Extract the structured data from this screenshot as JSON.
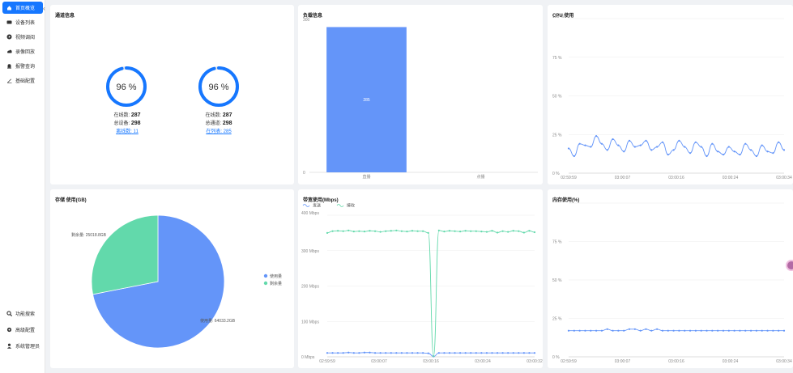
{
  "sidebar": {
    "collapse_glyph": "‹",
    "top_items": [
      {
        "label": "首页概览",
        "icon": "home-icon"
      },
      {
        "label": "设备列表",
        "icon": "device-icon"
      },
      {
        "label": "视频调阅",
        "icon": "video-icon"
      },
      {
        "label": "录像回放",
        "icon": "playback-icon"
      },
      {
        "label": "报警查询",
        "icon": "alarm-icon"
      },
      {
        "label": "基础配置",
        "icon": "config-icon"
      }
    ],
    "bottom_items": [
      {
        "label": "功能搜索",
        "icon": "search-icon"
      },
      {
        "label": "高级配置",
        "icon": "gear-icon"
      },
      {
        "label": "系统管理员",
        "icon": "user-icon"
      }
    ],
    "active_color": "#1677ff"
  },
  "resource": {
    "title": "通道信息",
    "gauges": [
      {
        "percent_label": "96 %",
        "percent": 96,
        "line1_label": "在线数:",
        "line1_value": "287",
        "line2_label": "总设备:",
        "line2_value": "298",
        "link_label": "离线数:",
        "link_value": "11"
      },
      {
        "percent_label": "96 %",
        "percent": 96,
        "line1_label": "在线数:",
        "line1_value": "287",
        "line2_label": "总通道:",
        "line2_value": "298",
        "link_label": "在列表:",
        "link_value": "285"
      }
    ]
  },
  "load": {
    "title": "负载信息",
    "chart_data": {
      "type": "bar",
      "categories": [
        "直播",
        "点播"
      ],
      "values": [
        285,
        0
      ],
      "data_labels": [
        "285",
        ""
      ],
      "ylim": [
        0,
        300
      ],
      "y_ticks": [
        "300",
        "0"
      ],
      "color": "#6495f9"
    }
  },
  "cpu": {
    "title": "CPU 使用",
    "chart_data": {
      "type": "line",
      "y_ticks": [
        "100 %",
        "75 %",
        "50 %",
        "25 %",
        "0 %"
      ],
      "x_ticks": [
        "02:59:59",
        "03:00:07",
        "03:00:16",
        "03:00:24",
        "03:00:34"
      ],
      "ylim": [
        0,
        100
      ],
      "values": [
        16,
        11,
        19,
        18,
        17,
        24,
        19,
        15,
        22,
        18,
        14,
        21,
        17,
        18,
        21,
        15,
        17,
        20,
        12,
        15,
        21,
        17,
        13,
        20,
        17,
        11,
        19,
        14,
        12,
        17,
        14,
        12,
        19,
        15,
        11,
        18,
        14,
        13,
        20,
        15
      ]
    }
  },
  "storage": {
    "title": "存储 使用(GB)",
    "chart_data": {
      "type": "pie",
      "slices": [
        {
          "name": "使用量",
          "value": 64033.2,
          "label": "使用量: 64033.2GB",
          "color": "#6495f9"
        },
        {
          "name": "剩余量",
          "value": 25018.8,
          "label": "剩余量: 25018.8GB",
          "color": "#62d9ab"
        }
      ],
      "legend": [
        "使用量",
        "剩余量"
      ],
      "legend_position": "right"
    }
  },
  "bandwidth": {
    "title": "带宽使用(Mbps)",
    "chart_data": {
      "type": "line",
      "legend": [
        "发送",
        "接收"
      ],
      "y_ticks": [
        "400 Mbps",
        "300 Mbps",
        "200 Mbps",
        "100 Mbps",
        "0 Mbps"
      ],
      "x_ticks": [
        "02:59:59",
        "03:00:07",
        "03:00:16",
        "03:00:24",
        "03:00:32"
      ],
      "ylim": [
        0,
        400
      ],
      "series": [
        {
          "name": "发送",
          "color": "#6495f9",
          "values": [
            11,
            11,
            11,
            11,
            12,
            11,
            11,
            12,
            12,
            11,
            11,
            11,
            11,
            11,
            11,
            11,
            11,
            11,
            11,
            10,
            1,
            11,
            11,
            11,
            11,
            11,
            11,
            11,
            11,
            11,
            11,
            11,
            11,
            11,
            11,
            11,
            11,
            11,
            11,
            11
          ]
        },
        {
          "name": "接收",
          "color": "#62d9ab",
          "values": [
            350,
            355,
            356,
            355,
            357,
            354,
            355,
            354,
            356,
            355,
            353,
            355,
            356,
            357,
            355,
            354,
            356,
            355,
            355,
            350,
            2,
            357,
            354,
            356,
            355,
            354,
            356,
            355,
            355,
            354,
            353,
            356,
            351,
            355,
            353,
            356,
            355,
            351,
            356,
            352
          ]
        }
      ]
    }
  },
  "memory": {
    "title": "内存使用(%)",
    "chart_data": {
      "type": "line",
      "y_ticks": [
        "100 %",
        "75 %",
        "50 %",
        "25 %",
        "0 %"
      ],
      "x_ticks": [
        "02:59:59",
        "03:00:07",
        "03:00:16",
        "03:00:24",
        "03:00:34"
      ],
      "ylim": [
        0,
        100
      ],
      "values": [
        17,
        17,
        17,
        17,
        17,
        17,
        17,
        18,
        17,
        17,
        17,
        18,
        18,
        17,
        18,
        17,
        18,
        17,
        17,
        17,
        17,
        17,
        17,
        17,
        17,
        17,
        17,
        17,
        17,
        17,
        17,
        17,
        17,
        17,
        17,
        17,
        17,
        17,
        17,
        17
      ]
    }
  }
}
